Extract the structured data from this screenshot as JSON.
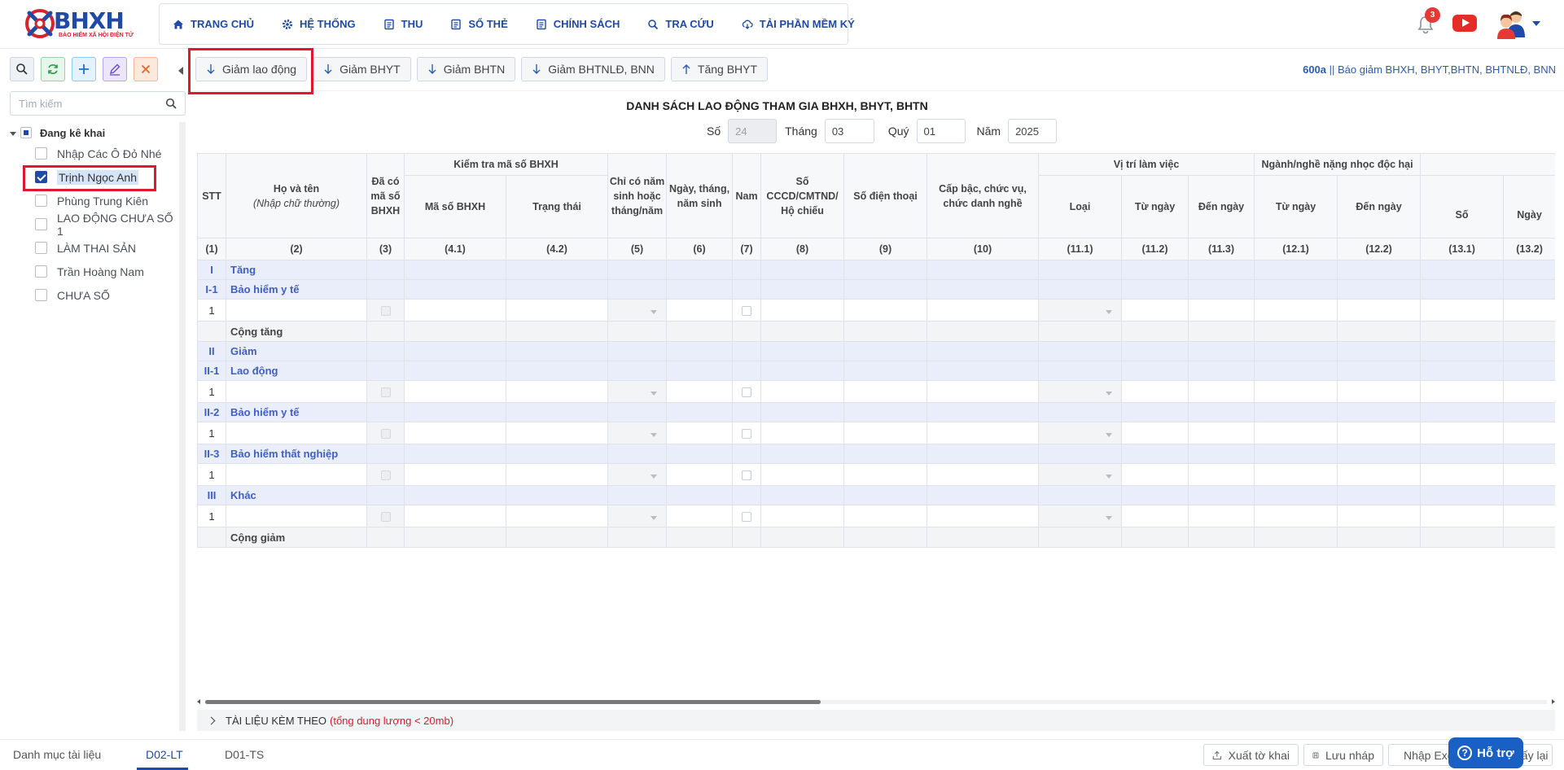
{
  "brand": {
    "name": "BHXH",
    "tagline": "BẢO HIỂM XÃ HỘI ĐIỆN TỬ"
  },
  "nav": [
    {
      "label": "TRANG CHỦ",
      "icon": "home-icon"
    },
    {
      "label": "HỆ THỐNG",
      "icon": "gear-icon"
    },
    {
      "label": "THU",
      "icon": "list-icon"
    },
    {
      "label": "SỔ THẺ",
      "icon": "list-icon"
    },
    {
      "label": "CHÍNH SÁCH",
      "icon": "list-icon"
    },
    {
      "label": "TRA CỨU",
      "icon": "search-icon"
    },
    {
      "label": "TẢI PHẦN MỀM KÝ",
      "icon": "cloud-download-icon"
    }
  ],
  "header": {
    "notification_count": "3"
  },
  "sidebar": {
    "search_placeholder": "Tìm kiếm",
    "tree_root": "Đang kê khai",
    "items": [
      {
        "label": "Nhập Các Ô Đỏ Nhé",
        "checked": false
      },
      {
        "label": "Trịnh Ngọc Anh",
        "checked": true
      },
      {
        "label": "Phùng Trung Kiên",
        "checked": false
      },
      {
        "label": "LAO ĐỘNG CHƯA SỐ 1",
        "checked": false
      },
      {
        "label": "LÀM THAI SẢN",
        "checked": false
      },
      {
        "label": "Trần Hoàng Nam",
        "checked": false
      },
      {
        "label": "CHƯA SỐ",
        "checked": false
      }
    ]
  },
  "toolbar": {
    "buttons": [
      {
        "label": "Giảm lao động",
        "icon": "arrow-down-icon"
      },
      {
        "label": "Giảm BHYT",
        "icon": "arrow-down-icon"
      },
      {
        "label": "Giảm BHTN",
        "icon": "arrow-down-icon"
      },
      {
        "label": "Giảm BHTNLĐ, BNN",
        "icon": "arrow-down-icon"
      },
      {
        "label": "Tăng BHYT",
        "icon": "arrow-up-icon"
      }
    ],
    "form_code": "600a",
    "form_desc": " || Báo giảm BHXH, BHYT,BHTN, BHTNLĐ, BNN"
  },
  "document": {
    "title": "DANH SÁCH LAO ĐỘNG THAM GIA BHXH, BHYT, BHTN",
    "so_label": "Số",
    "so_value": "24",
    "thang_label": "Tháng",
    "thang_value": "03",
    "quy_label": "Quý",
    "quy_value": "01",
    "nam_label": "Năm",
    "nam_value": "2025"
  },
  "table": {
    "headers": {
      "stt": "STT",
      "ho_ten": "Họ và tên",
      "ho_ten_note": "(Nhập chữ thường)",
      "da_co_ma": "Đã có mã số BHXH",
      "kiem_tra": "Kiểm tra mã số BHXH",
      "ma_so": "Mã số BHXH",
      "trang_thai": "Trạng thái",
      "chi_co_nam": "Chỉ có năm sinh hoặc tháng/năm",
      "ngay_sinh": "Ngày, tháng, năm sinh",
      "nam": "Nam",
      "cccd": "Số CCCD/CMTND/ Hộ chiếu",
      "sdt": "Số điện thoại",
      "cap_bac": "Cấp bậc, chức vụ, chức danh nghề",
      "vi_tri": "Vị trí làm việc",
      "loai": "Loại",
      "tu_ngay": "Từ ngày",
      "den_ngay": "Đến ngày",
      "nganh_nghe": "Ngành/nghề nặng nhọc độc hại",
      "so": "Số",
      "ngay": "Ngày"
    },
    "col_numbers": [
      "(1)",
      "(2)",
      "(3)",
      "(4.1)",
      "(4.2)",
      "(5)",
      "(6)",
      "(7)",
      "(8)",
      "(9)",
      "(10)",
      "(11.1)",
      "(11.2)",
      "(11.3)",
      "(12.1)",
      "(12.2)",
      "(13.1)",
      "(13.2)"
    ],
    "rows": [
      {
        "type": "sec",
        "stt": "I",
        "label": "Tăng"
      },
      {
        "type": "sec",
        "stt": "I-1",
        "label": "Bảo hiểm y tế"
      },
      {
        "type": "dat",
        "stt": "1"
      },
      {
        "type": "tot",
        "stt": "",
        "label": "Cộng tăng"
      },
      {
        "type": "sec",
        "stt": "II",
        "label": "Giảm"
      },
      {
        "type": "sec",
        "stt": "II-1",
        "label": "Lao động"
      },
      {
        "type": "dat",
        "stt": "1"
      },
      {
        "type": "sec",
        "stt": "II-2",
        "label": "Bảo hiểm y tế"
      },
      {
        "type": "dat",
        "stt": "1"
      },
      {
        "type": "sec",
        "stt": "II-3",
        "label": "Bảo hiểm thất nghiệp"
      },
      {
        "type": "dat",
        "stt": "1"
      },
      {
        "type": "sec",
        "stt": "III",
        "label": "Khác"
      },
      {
        "type": "dat",
        "stt": "1"
      },
      {
        "type": "tot",
        "stt": "",
        "label": "Cộng giảm"
      }
    ]
  },
  "attachments": {
    "label": "TÀI LIỆU KÈM THEO",
    "note": "(tổng dung lượng < 20mb)"
  },
  "footer": {
    "tabs": [
      "Danh mục tài liệu",
      "D02-LT",
      "D01-TS"
    ],
    "active_tab": "D02-LT",
    "buttons": [
      "Xuất tờ khai",
      "Lưu nháp",
      "Nhập Excel",
      "Lấy lại"
    ],
    "help_label": "Hỗ trợ"
  },
  "colors": {
    "brand_blue": "#1f4aa8",
    "highlight_red": "#e0182d",
    "section_bg": "#eaeefb"
  }
}
